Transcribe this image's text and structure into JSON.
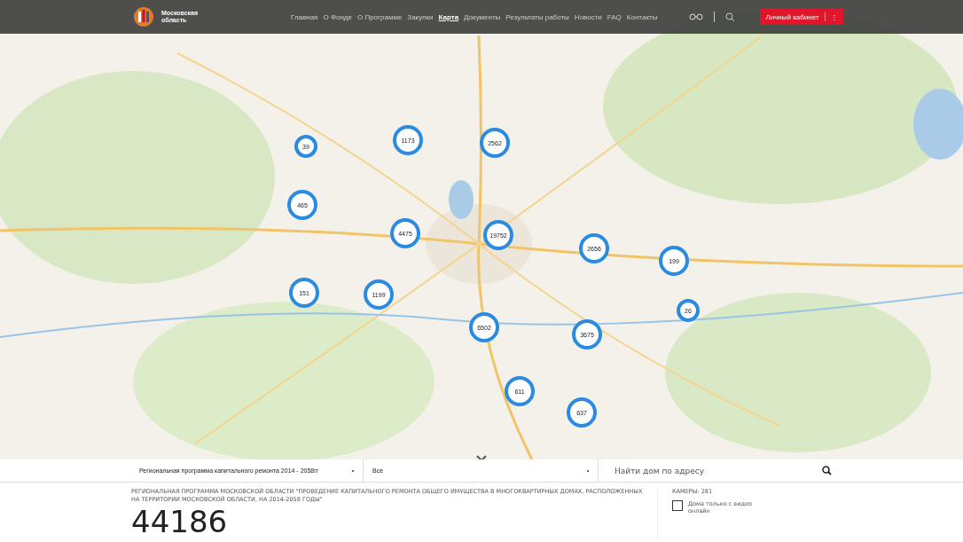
{
  "header": {
    "logo_text": "Московская область",
    "nav": [
      {
        "label": "Главная",
        "selected": false
      },
      {
        "label": "О Фонде",
        "selected": false
      },
      {
        "label": "О Программе",
        "selected": false
      },
      {
        "label": "Закупки",
        "selected": false
      },
      {
        "label": "Карта",
        "selected": true
      },
      {
        "label": "Документы",
        "selected": false
      },
      {
        "label": "Результаты работы",
        "selected": false
      },
      {
        "label": "Новости",
        "selected": false
      },
      {
        "label": "FAQ",
        "selected": false
      },
      {
        "label": "Контакты",
        "selected": false
      }
    ],
    "account_button": "Личный кабинет",
    "account_menu": "⋮"
  },
  "map": {
    "clusters": [
      {
        "count": "39"
      },
      {
        "count": "1173"
      },
      {
        "count": "2562"
      },
      {
        "count": "465"
      },
      {
        "count": "4475"
      },
      {
        "count": "19752"
      },
      {
        "count": "2656"
      },
      {
        "count": "199"
      },
      {
        "count": "151"
      },
      {
        "count": "1199"
      },
      {
        "count": "26"
      },
      {
        "count": "6502"
      },
      {
        "count": "3675"
      },
      {
        "count": "611"
      },
      {
        "count": "637"
      }
    ]
  },
  "filters": {
    "program": "Региональная программа капитального ремонта 2014 - 2058гг",
    "type": "Все",
    "search": {
      "placeholder": "Найти дом по адресу"
    }
  },
  "summary": {
    "description": "РЕГИОНАЛЬНАЯ ПРОГРАММА МОСКОВСКОЙ ОБЛАСТИ \"ПРОВЕДЕНИЕ КАПИТАЛЬНОГО РЕМОНТА ОБЩЕГО ИМУЩЕСТВА В МНОГОКВАРТИРНЫХ ДОМАХ, РАСПОЛОЖЕННЫХ НА ТЕРРИТОРИИ МОСКОВСКОЙ ОБЛАСТИ, НА 2014-2058 ГОДЫ\"",
    "total": "44186",
    "cameras": "КАМЕРЫ: 281",
    "video_only": {
      "label": "Дома только с видео онлайн",
      "checked": false
    }
  }
}
